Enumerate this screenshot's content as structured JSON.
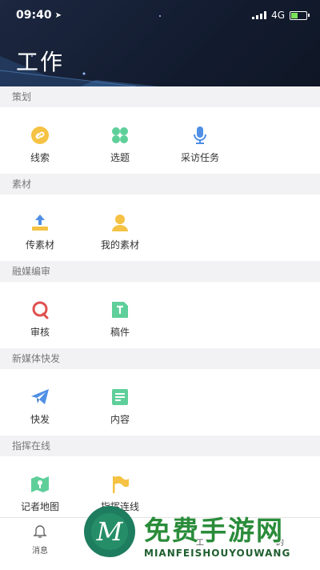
{
  "status_bar": {
    "time": "09:40",
    "network": "4G"
  },
  "header": {
    "title": "工作"
  },
  "sections": [
    {
      "label": "策划",
      "items": [
        {
          "label": "线索",
          "icon": "link-icon"
        },
        {
          "label": "选题",
          "icon": "clover-icon"
        },
        {
          "label": "采访任务",
          "icon": "microphone-icon"
        }
      ]
    },
    {
      "label": "素材",
      "items": [
        {
          "label": "传素材",
          "icon": "upload-icon"
        },
        {
          "label": "我的素材",
          "icon": "user-icon"
        }
      ]
    },
    {
      "label": "融媒编审",
      "items": [
        {
          "label": "审核",
          "icon": "review-icon"
        },
        {
          "label": "稿件",
          "icon": "document-icon"
        }
      ]
    },
    {
      "label": "新媒体快发",
      "items": [
        {
          "label": "快发",
          "icon": "paper-plane-icon"
        },
        {
          "label": "内容",
          "icon": "content-list-icon"
        }
      ]
    },
    {
      "label": "指挥在线",
      "items": [
        {
          "label": "记者地图",
          "icon": "map-icon"
        },
        {
          "label": "指挥连线",
          "icon": "flag-icon"
        }
      ]
    }
  ],
  "tabbar": {
    "items": [
      {
        "label": "消息",
        "icon": "bell-icon"
      },
      {
        "label": "",
        "icon": ""
      },
      {
        "label": "工",
        "icon": "work-icon"
      },
      {
        "label": "的",
        "icon": "profile-icon"
      }
    ]
  },
  "watermark": {
    "brand": "免费手游网",
    "sub": "MIANFEISHOUYOUWANG",
    "logo_letter": "M"
  },
  "colors": {
    "header": "#1a2438",
    "yellow": "#f5c243",
    "green": "#5fcf9a",
    "blue": "#4f8fe6",
    "red": "#e05050",
    "watermark": "#2a8c3a"
  }
}
